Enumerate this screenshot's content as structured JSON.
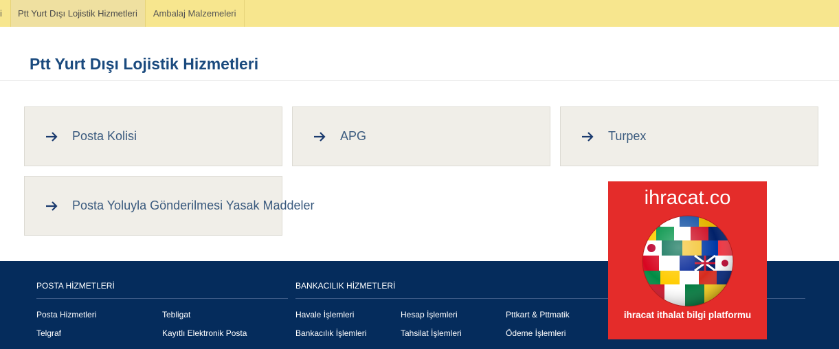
{
  "tabs": [
    {
      "label": "i",
      "state": "partial"
    },
    {
      "label": "Ptt Yurt Dışı Lojistik Hizmetleri",
      "state": "active"
    },
    {
      "label": "Ambalaj Malzemeleri",
      "state": "normal"
    }
  ],
  "page_title": "Ptt Yurt Dışı Lojistik Hizmetleri",
  "cards": [
    {
      "label": "Posta Kolisi",
      "icon": "arrow-right-icon"
    },
    {
      "label": "APG",
      "icon": "arrow-right-icon"
    },
    {
      "label": "Turpex",
      "icon": "arrow-right-icon"
    },
    {
      "label": "Posta Yoluyla Gönderilmesi Yasak Maddeler",
      "icon": "arrow-right-icon"
    }
  ],
  "footer": {
    "posta": {
      "heading": "POSTA HİZMETLERİ",
      "links": [
        "Posta Hizmetleri",
        "Tebligat",
        "Telgraf",
        "Kayıtlı Elektronik Posta"
      ]
    },
    "banka": {
      "heading": "BANKACILIK HİZMETLERİ",
      "links": [
        "Havale İşlemleri",
        "Hesap İşlemleri",
        "Pttkart & Pttmatik",
        "Bankacılık İşlemleri",
        "Tahsilat İşlemleri",
        "Ödeme İşlemleri"
      ]
    }
  },
  "ad": {
    "title": "ihracat.co",
    "subtitle": "ihracat ithalat bilgi platformu"
  },
  "colors": {
    "topbar": "#f7e68e",
    "title": "#1a4a7e",
    "card_bg": "#f0eee8",
    "footer_bg": "#052c5c",
    "ad_bg": "#e42c2a"
  }
}
